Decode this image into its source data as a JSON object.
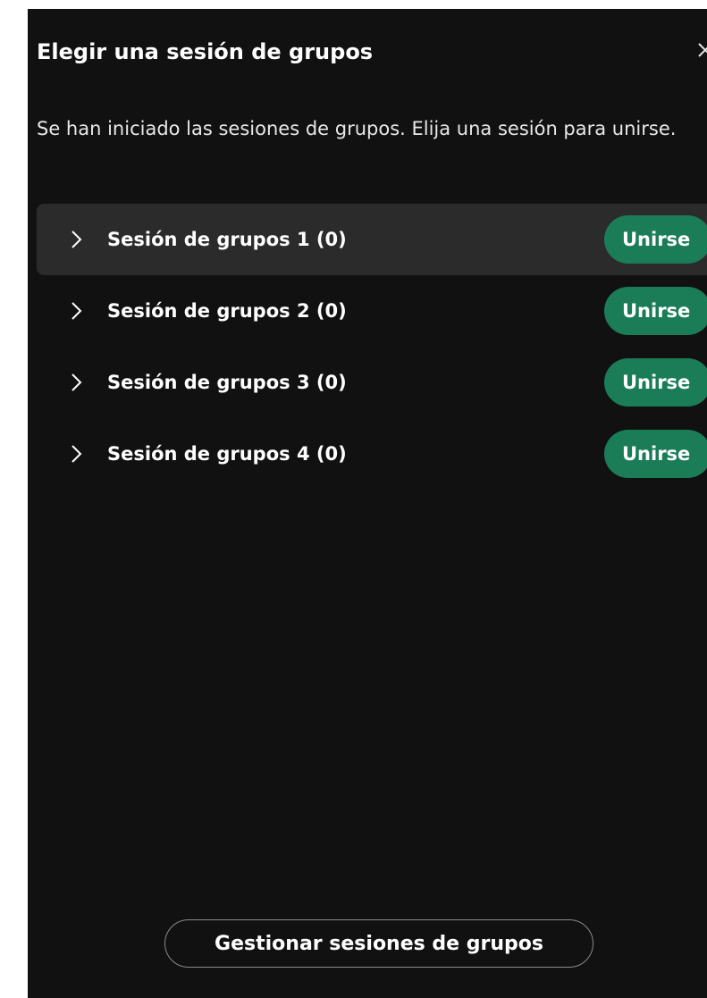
{
  "dialog": {
    "title": "Elegir una sesión de grupos",
    "close_icon": "close-icon",
    "description": "Se han iniciado las sesiones de grupos. Elija una sesión para unirse."
  },
  "sessions": [
    {
      "label": "Sesión de grupos 1 (0)",
      "join_label": "Unirse",
      "active": true
    },
    {
      "label": "Sesión de grupos 2 (0)",
      "join_label": "Unirse",
      "active": false
    },
    {
      "label": "Sesión de grupos 3 (0)",
      "join_label": "Unirse",
      "active": false
    },
    {
      "label": "Sesión de grupos 4 (0)",
      "join_label": "Unirse",
      "active": false
    }
  ],
  "footer": {
    "manage_label": "Gestionar sesiones de grupos"
  },
  "colors": {
    "background": "#111111",
    "active_row": "#2b2b2b",
    "join_button": "#1a7d58",
    "text": "#ffffff"
  }
}
